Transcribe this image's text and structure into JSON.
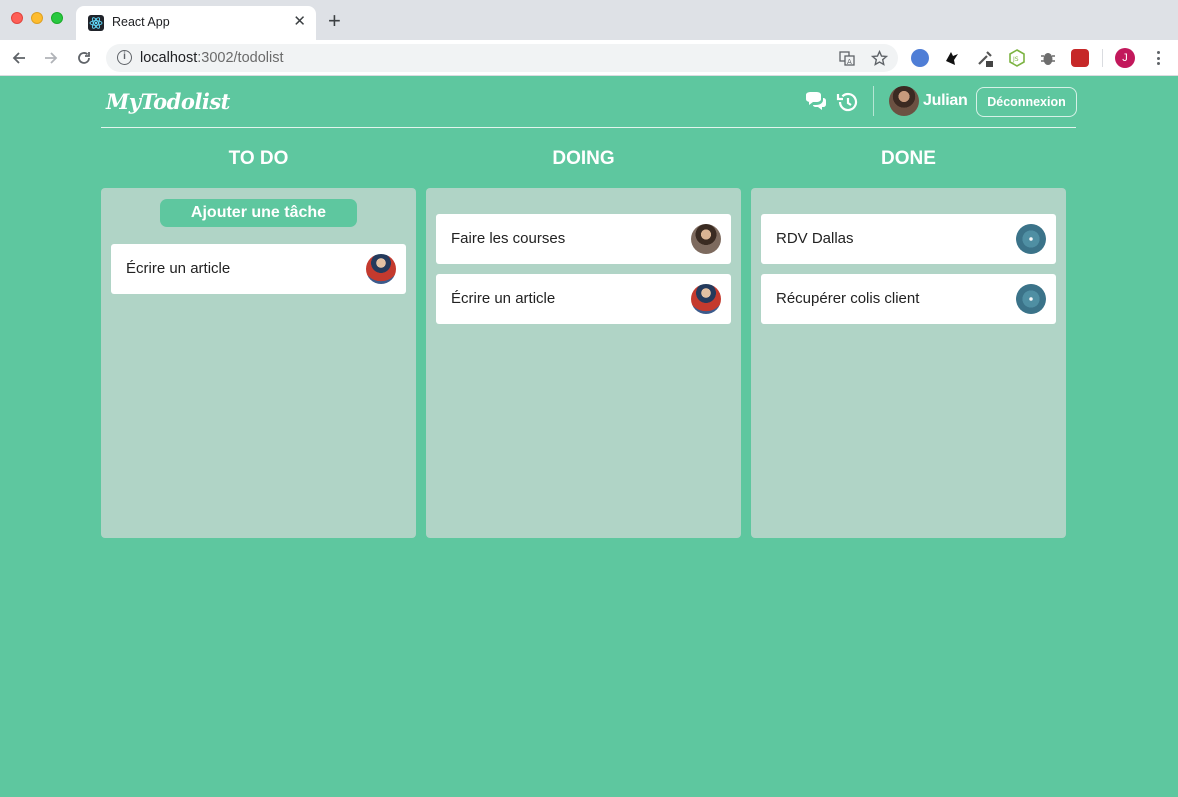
{
  "browser": {
    "tab_title": "React App",
    "url_host": "localhost",
    "url_path": ":3002/todolist",
    "profile_initial": "J"
  },
  "header": {
    "logo": "MyTodolist",
    "username": "Julian",
    "logout_label": "Déconnexion"
  },
  "columns": [
    {
      "title": "TO DO",
      "add_label": "Ajouter une tâche",
      "cards": [
        {
          "text": "Écrire un article",
          "avatar": "user-avatar"
        }
      ]
    },
    {
      "title": "DOING",
      "cards": [
        {
          "text": "Faire les courses",
          "avatar": "user-avatar"
        },
        {
          "text": "Écrire un article",
          "avatar": "user-avatar"
        }
      ]
    },
    {
      "title": "DONE",
      "cards": [
        {
          "text": "RDV Dallas",
          "avatar": "user-avatar"
        },
        {
          "text": "Récupérer colis client",
          "avatar": "user-avatar"
        }
      ]
    }
  ],
  "colors": {
    "background": "#5ec79f",
    "column": "#b0d4c6",
    "card": "#ffffff"
  }
}
